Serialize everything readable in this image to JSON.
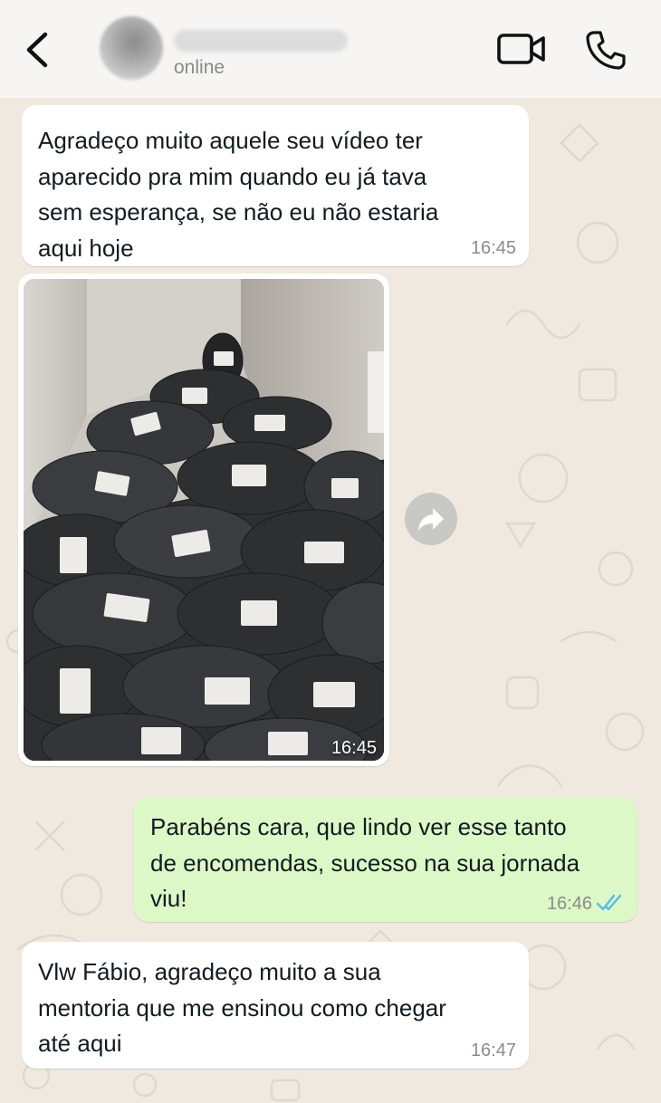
{
  "header": {
    "status": "online",
    "icons": {
      "back": "chevron-left-icon",
      "video": "video-camera-icon",
      "call": "phone-icon"
    }
  },
  "messages": [
    {
      "direction": "incoming",
      "type": "text",
      "lines": [
        "Agradeço muito aquele seu vídeo ter",
        "aparecido pra mim quando eu já tava",
        "sem esperança, se não eu não estaria",
        "aqui hoje"
      ],
      "time": "16:45"
    },
    {
      "direction": "incoming",
      "type": "image",
      "image_description_icon": "photo-of-packages",
      "time": "16:45"
    },
    {
      "direction": "outgoing",
      "type": "text",
      "lines": [
        "Parabéns cara, que lindo ver esse tanto",
        "de encomendas, sucesso na sua jornada",
        "viu!"
      ],
      "time": "16:46",
      "read": true
    },
    {
      "direction": "incoming",
      "type": "text",
      "lines": [
        "Vlw Fábio, agradeço muito a sua",
        "mentoria que me ensinou como chegar",
        "até aqui"
      ],
      "time": "16:47"
    }
  ],
  "colors": {
    "header_bg": "#f6f5f3",
    "chat_bg": "#efe9df",
    "incoming_bubble": "#ffffff",
    "outgoing_bubble": "#dcf8c6",
    "read_ticks": "#53bdeb"
  }
}
